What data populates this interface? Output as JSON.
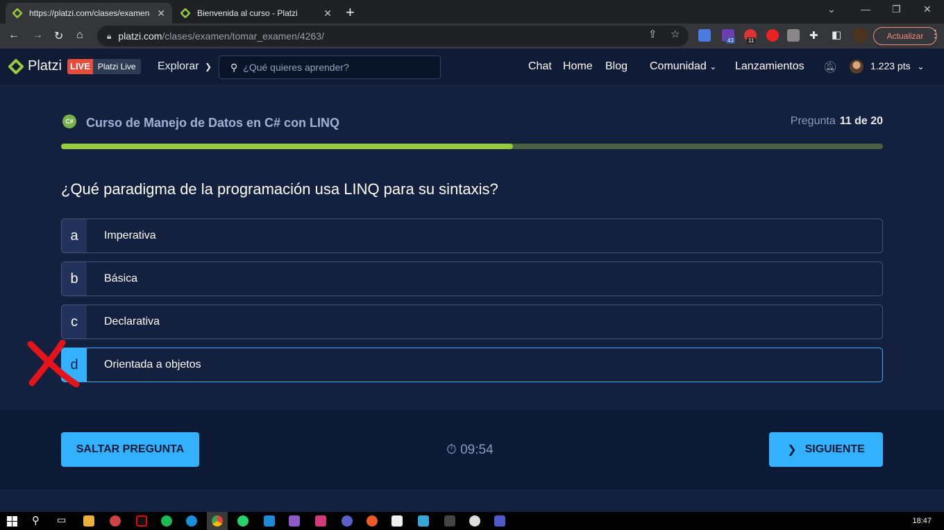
{
  "browser": {
    "tabs": [
      {
        "title": "https://platzi.com/clases/examen",
        "active": true
      },
      {
        "title": "Bienvenida al curso - Platzi",
        "active": false
      }
    ],
    "url_host": "platzi.com",
    "url_path": "/clases/examen/tomar_examen/4263/",
    "update_label": "Actualizar",
    "extension_badges": {
      "first": "43",
      "second": "11"
    }
  },
  "header": {
    "logo_text": "Platzi",
    "live_label": "LIVE",
    "live_name": "Platzi Live",
    "explore_label": "Explorar",
    "search_placeholder": "¿Qué quieres aprender?",
    "nav": [
      "Chat",
      "Home",
      "Blog",
      "Comunidad",
      "Lanzamientos"
    ],
    "points": "1.223 pts"
  },
  "exam": {
    "course_icon_text": "C#",
    "course_title": "Curso de Manejo de Datos en C# con LINQ",
    "question_label": "Pregunta",
    "question_progress": "11 de 20",
    "progress_fraction": 0.55,
    "question": "¿Qué paradigma de la programación usa LINQ para su sintaxis?",
    "options": [
      {
        "letter": "a",
        "text": "Imperativa"
      },
      {
        "letter": "b",
        "text": "Básica"
      },
      {
        "letter": "c",
        "text": "Declarativa"
      },
      {
        "letter": "d",
        "text": "Orientada a objetos",
        "selected": true
      }
    ]
  },
  "footer": {
    "skip_label": "SALTAR PREGUNTA",
    "timer": "09:54",
    "next_label": "SIGUIENTE"
  },
  "taskbar": {
    "clock": "18:47"
  },
  "colors": {
    "accent": "#33b1ff",
    "progress_fill": "#98ca3f",
    "progress_track": "#4b5f41",
    "background": "#13213f",
    "annotation_red": "#e5141b"
  }
}
